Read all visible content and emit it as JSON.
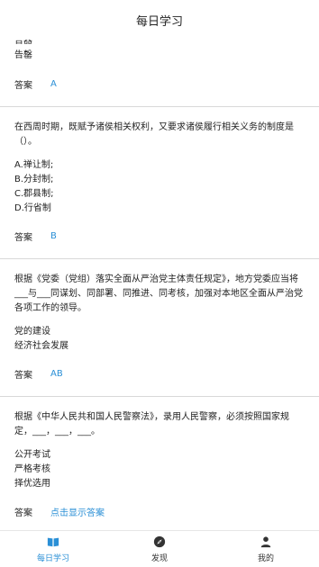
{
  "header": {
    "title": "每日学习"
  },
  "q0": {
    "options": [
      "告器",
      "告罄"
    ],
    "answer_label": "答案",
    "answer": "A"
  },
  "q1": {
    "question": "在西周时期，既赋予诸侯相关权利，又要求诸侯履行相关义务的制度是（）。",
    "options": [
      "A.禅让制;",
      "B.分封制;",
      "C.郡县制;",
      "D.行省制"
    ],
    "answer_label": "答案",
    "answer": "B"
  },
  "q2": {
    "question": "根据《党委（党组）落实全面从严治党主体责任规定》，地方党委应当将___与___同谋划、同部署、同推进、同考核，加强对本地区全面从严治党各项工作的领导。",
    "options": [
      "党的建设",
      "经济社会发展"
    ],
    "answer_label": "答案",
    "answer": "AB"
  },
  "q3": {
    "question": "根据《中华人民共和国人民警察法》，录用人民警察，必须按照国家规定，___，___，___。",
    "options": [
      "公开考试",
      "严格考核",
      "择优选用"
    ],
    "answer_label": "答案",
    "answer": "点击显示答案"
  },
  "tabbar": {
    "tabs": [
      {
        "label": "每日学习",
        "icon": "book-icon",
        "active": true
      },
      {
        "label": "发现",
        "icon": "compass-icon",
        "active": false
      },
      {
        "label": "我的",
        "icon": "person-icon",
        "active": false
      }
    ],
    "active_color": "#2a8fd6"
  }
}
